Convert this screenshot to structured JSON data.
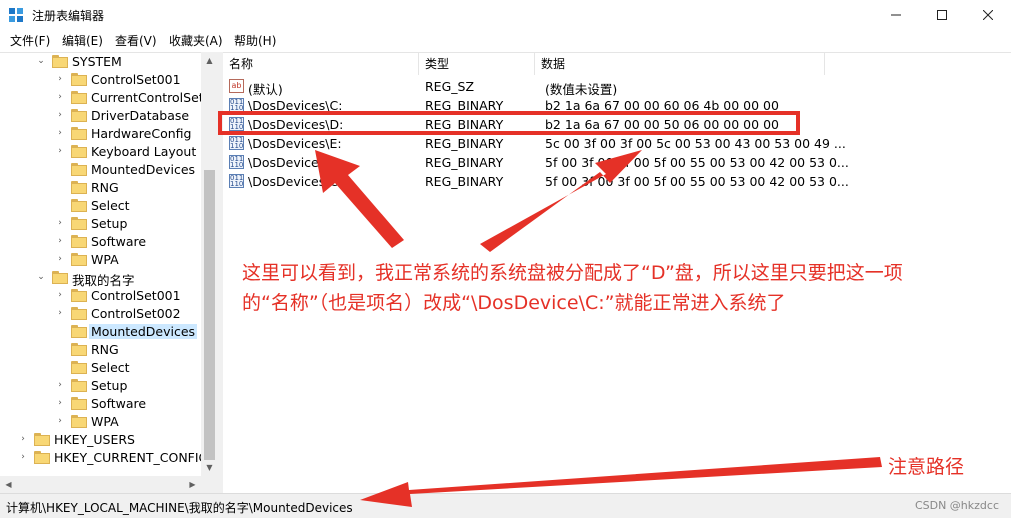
{
  "window": {
    "title": "注册表编辑器"
  },
  "menu": [
    "文件(F)",
    "编辑(E)",
    "查看(V)",
    "收藏夹(A)",
    "帮助(H)"
  ],
  "tree": [
    {
      "label": "SYSTEM",
      "exp": "v",
      "indent": 0
    },
    {
      "label": "ControlSet001",
      "exp": ">",
      "indent": 1
    },
    {
      "label": "CurrentControlSet",
      "exp": ">",
      "indent": 1
    },
    {
      "label": "DriverDatabase",
      "exp": ">",
      "indent": 1
    },
    {
      "label": "HardwareConfig",
      "exp": ">",
      "indent": 1
    },
    {
      "label": "Keyboard Layout",
      "exp": ">",
      "indent": 1
    },
    {
      "label": "MountedDevices",
      "exp": "",
      "indent": 1
    },
    {
      "label": "RNG",
      "exp": "",
      "indent": 1
    },
    {
      "label": "Select",
      "exp": "",
      "indent": 1
    },
    {
      "label": "Setup",
      "exp": ">",
      "indent": 1
    },
    {
      "label": "Software",
      "exp": ">",
      "indent": 1
    },
    {
      "label": "WPA",
      "exp": ">",
      "indent": 1
    },
    {
      "label": "我取的名字",
      "exp": "v",
      "indent": 0
    },
    {
      "label": "ControlSet001",
      "exp": ">",
      "indent": 1
    },
    {
      "label": "ControlSet002",
      "exp": ">",
      "indent": 1
    },
    {
      "label": "MountedDevices",
      "exp": "",
      "indent": 1,
      "selected": true
    },
    {
      "label": "RNG",
      "exp": "",
      "indent": 1
    },
    {
      "label": "Select",
      "exp": "",
      "indent": 1
    },
    {
      "label": "Setup",
      "exp": ">",
      "indent": 1
    },
    {
      "label": "Software",
      "exp": ">",
      "indent": 1
    },
    {
      "label": "WPA",
      "exp": ">",
      "indent": 1
    },
    {
      "label": "HKEY_USERS",
      "exp": ">",
      "indent": -1
    },
    {
      "label": "HKEY_CURRENT_CONFIG",
      "exp": ">",
      "indent": -1
    }
  ],
  "columns": {
    "name": "名称",
    "type": "类型",
    "data": "数据"
  },
  "values": [
    {
      "name": "(默认)",
      "type": "REG_SZ",
      "data": "(数值未设置)",
      "icon": "ab"
    },
    {
      "name": "\\DosDevices\\C:",
      "type": "REG_BINARY",
      "data": "b2 1a 6a 67 00 00 60 06 4b 00 00 00",
      "icon": "bin"
    },
    {
      "name": "\\DosDevices\\D:",
      "type": "REG_BINARY",
      "data": "b2 1a 6a 67 00 00 50 06 00 00 00 00",
      "icon": "bin"
    },
    {
      "name": "\\DosDevices\\E:",
      "type": "REG_BINARY",
      "data": "5c 00 3f 00 3f 00 5c 00 53 00 43 00 53 00 49 ...",
      "icon": "bin"
    },
    {
      "name": "\\DosDevice",
      "type": "REG_BINARY",
      "data": "5f 00 3f 00 3f 00 5f 00 55 00 53 00 42 00 53 0...",
      "icon": "bin"
    },
    {
      "name": "\\DosDevices\\C",
      "type": "REG_BINARY",
      "data": "5f 00 3f 00 3f 00 5f 00 55 00 53 00 42 00 53 0...",
      "icon": "bin"
    }
  ],
  "status": {
    "path": "计算机\\HKEY_LOCAL_MACHINE\\我取的名字\\MountedDevices",
    "watermark": "CSDN @hkzdcc"
  },
  "annotations": {
    "line1": "这里可以看到，我正常系统的系统盘被分配成了“D”盘，所以这里只要把这一项",
    "line2": "的“名称”（也是项名）改成“\\DosDevice\\C:”就能正常进入系统了",
    "path_note": "注意路径",
    "color": "#e53127"
  }
}
